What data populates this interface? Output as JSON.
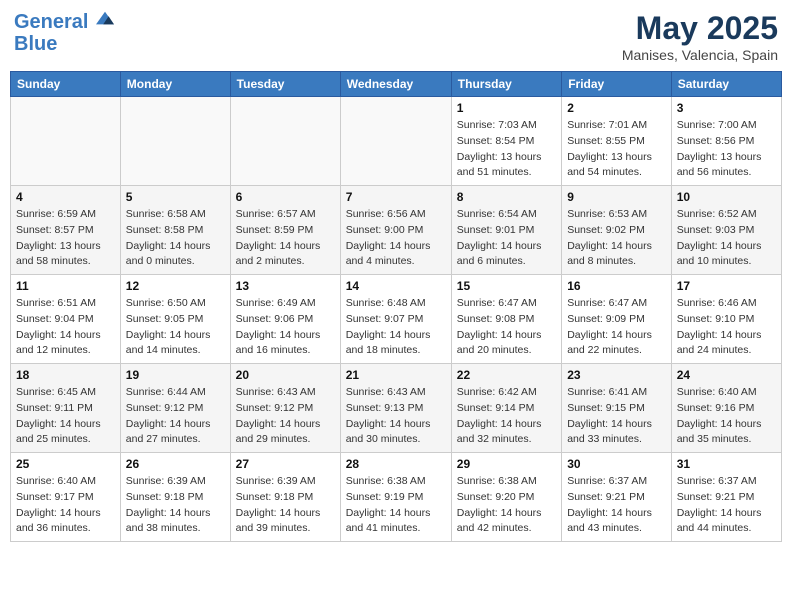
{
  "header": {
    "logo_line1": "General",
    "logo_line2": "Blue",
    "month_year": "May 2025",
    "location": "Manises, Valencia, Spain"
  },
  "days_of_week": [
    "Sunday",
    "Monday",
    "Tuesday",
    "Wednesday",
    "Thursday",
    "Friday",
    "Saturday"
  ],
  "weeks": [
    [
      {
        "day": "",
        "info": ""
      },
      {
        "day": "",
        "info": ""
      },
      {
        "day": "",
        "info": ""
      },
      {
        "day": "",
        "info": ""
      },
      {
        "day": "1",
        "info": "Sunrise: 7:03 AM\nSunset: 8:54 PM\nDaylight: 13 hours\nand 51 minutes."
      },
      {
        "day": "2",
        "info": "Sunrise: 7:01 AM\nSunset: 8:55 PM\nDaylight: 13 hours\nand 54 minutes."
      },
      {
        "day": "3",
        "info": "Sunrise: 7:00 AM\nSunset: 8:56 PM\nDaylight: 13 hours\nand 56 minutes."
      }
    ],
    [
      {
        "day": "4",
        "info": "Sunrise: 6:59 AM\nSunset: 8:57 PM\nDaylight: 13 hours\nand 58 minutes."
      },
      {
        "day": "5",
        "info": "Sunrise: 6:58 AM\nSunset: 8:58 PM\nDaylight: 14 hours\nand 0 minutes."
      },
      {
        "day": "6",
        "info": "Sunrise: 6:57 AM\nSunset: 8:59 PM\nDaylight: 14 hours\nand 2 minutes."
      },
      {
        "day": "7",
        "info": "Sunrise: 6:56 AM\nSunset: 9:00 PM\nDaylight: 14 hours\nand 4 minutes."
      },
      {
        "day": "8",
        "info": "Sunrise: 6:54 AM\nSunset: 9:01 PM\nDaylight: 14 hours\nand 6 minutes."
      },
      {
        "day": "9",
        "info": "Sunrise: 6:53 AM\nSunset: 9:02 PM\nDaylight: 14 hours\nand 8 minutes."
      },
      {
        "day": "10",
        "info": "Sunrise: 6:52 AM\nSunset: 9:03 PM\nDaylight: 14 hours\nand 10 minutes."
      }
    ],
    [
      {
        "day": "11",
        "info": "Sunrise: 6:51 AM\nSunset: 9:04 PM\nDaylight: 14 hours\nand 12 minutes."
      },
      {
        "day": "12",
        "info": "Sunrise: 6:50 AM\nSunset: 9:05 PM\nDaylight: 14 hours\nand 14 minutes."
      },
      {
        "day": "13",
        "info": "Sunrise: 6:49 AM\nSunset: 9:06 PM\nDaylight: 14 hours\nand 16 minutes."
      },
      {
        "day": "14",
        "info": "Sunrise: 6:48 AM\nSunset: 9:07 PM\nDaylight: 14 hours\nand 18 minutes."
      },
      {
        "day": "15",
        "info": "Sunrise: 6:47 AM\nSunset: 9:08 PM\nDaylight: 14 hours\nand 20 minutes."
      },
      {
        "day": "16",
        "info": "Sunrise: 6:47 AM\nSunset: 9:09 PM\nDaylight: 14 hours\nand 22 minutes."
      },
      {
        "day": "17",
        "info": "Sunrise: 6:46 AM\nSunset: 9:10 PM\nDaylight: 14 hours\nand 24 minutes."
      }
    ],
    [
      {
        "day": "18",
        "info": "Sunrise: 6:45 AM\nSunset: 9:11 PM\nDaylight: 14 hours\nand 25 minutes."
      },
      {
        "day": "19",
        "info": "Sunrise: 6:44 AM\nSunset: 9:12 PM\nDaylight: 14 hours\nand 27 minutes."
      },
      {
        "day": "20",
        "info": "Sunrise: 6:43 AM\nSunset: 9:12 PM\nDaylight: 14 hours\nand 29 minutes."
      },
      {
        "day": "21",
        "info": "Sunrise: 6:43 AM\nSunset: 9:13 PM\nDaylight: 14 hours\nand 30 minutes."
      },
      {
        "day": "22",
        "info": "Sunrise: 6:42 AM\nSunset: 9:14 PM\nDaylight: 14 hours\nand 32 minutes."
      },
      {
        "day": "23",
        "info": "Sunrise: 6:41 AM\nSunset: 9:15 PM\nDaylight: 14 hours\nand 33 minutes."
      },
      {
        "day": "24",
        "info": "Sunrise: 6:40 AM\nSunset: 9:16 PM\nDaylight: 14 hours\nand 35 minutes."
      }
    ],
    [
      {
        "day": "25",
        "info": "Sunrise: 6:40 AM\nSunset: 9:17 PM\nDaylight: 14 hours\nand 36 minutes."
      },
      {
        "day": "26",
        "info": "Sunrise: 6:39 AM\nSunset: 9:18 PM\nDaylight: 14 hours\nand 38 minutes."
      },
      {
        "day": "27",
        "info": "Sunrise: 6:39 AM\nSunset: 9:18 PM\nDaylight: 14 hours\nand 39 minutes."
      },
      {
        "day": "28",
        "info": "Sunrise: 6:38 AM\nSunset: 9:19 PM\nDaylight: 14 hours\nand 41 minutes."
      },
      {
        "day": "29",
        "info": "Sunrise: 6:38 AM\nSunset: 9:20 PM\nDaylight: 14 hours\nand 42 minutes."
      },
      {
        "day": "30",
        "info": "Sunrise: 6:37 AM\nSunset: 9:21 PM\nDaylight: 14 hours\nand 43 minutes."
      },
      {
        "day": "31",
        "info": "Sunrise: 6:37 AM\nSunset: 9:21 PM\nDaylight: 14 hours\nand 44 minutes."
      }
    ]
  ]
}
